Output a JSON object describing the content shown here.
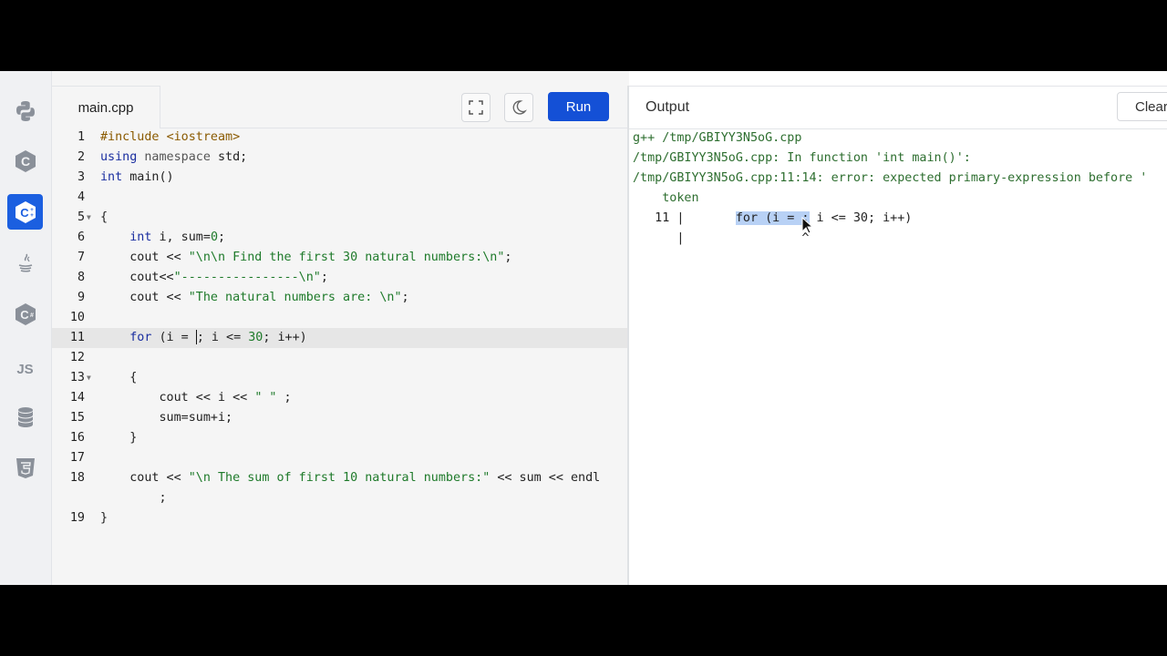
{
  "sidebar": {
    "languages": [
      {
        "name": "Python",
        "icon": "python-icon"
      },
      {
        "name": "C",
        "icon": "c-icon"
      },
      {
        "name": "C++",
        "icon": "cpp-icon",
        "active": true
      },
      {
        "name": "Java",
        "icon": "java-icon"
      },
      {
        "name": "C#",
        "icon": "csharp-icon"
      },
      {
        "name": "JavaScript",
        "icon": "js-icon",
        "label": "JS"
      },
      {
        "name": "SQL",
        "icon": "database-icon"
      },
      {
        "name": "HTML",
        "icon": "html5-icon"
      }
    ]
  },
  "editor": {
    "file_name": "main.cpp",
    "run_label": "Run",
    "active_line": 11,
    "lines": [
      {
        "n": "1",
        "text": "#include <iostream>"
      },
      {
        "n": "2",
        "text": "using namespace std;"
      },
      {
        "n": "3",
        "text": "int main()"
      },
      {
        "n": "4",
        "text": ""
      },
      {
        "n": "5",
        "text": "{"
      },
      {
        "n": "6",
        "text": "    int i, sum=0;"
      },
      {
        "n": "7",
        "text": "    cout << \"\\n\\n Find the first 30 natural numbers:\\n\";"
      },
      {
        "n": "8",
        "text": "    cout<<\"----------------\\n\";"
      },
      {
        "n": "9",
        "text": "    cout << \"The natural numbers are: \\n\";"
      },
      {
        "n": "10",
        "text": ""
      },
      {
        "n": "11",
        "text": "    for (i = ; i <= 30; i++)"
      },
      {
        "n": "12",
        "text": ""
      },
      {
        "n": "13",
        "text": "    {"
      },
      {
        "n": "14",
        "text": "        cout << i << \" \" ;"
      },
      {
        "n": "15",
        "text": "        sum=sum+i;"
      },
      {
        "n": "16",
        "text": "    }"
      },
      {
        "n": "17",
        "text": ""
      },
      {
        "n": "18",
        "text": "    cout << \"\\n The sum of first 10 natural numbers:\" << sum << endl"
      },
      {
        "n": "",
        "text": "        ;"
      },
      {
        "n": "19",
        "text": "}"
      }
    ]
  },
  "output": {
    "title": "Output",
    "clear_label": "Clear",
    "lines": [
      "g++ /tmp/GBIYY3N5oG.cpp",
      "/tmp/GBIYY3N5oG.cpp: In function 'int main()':",
      "/tmp/GBIYY3N5oG.cpp:11:14: error: expected primary-expression before '",
      "    token",
      "   11 |       for (i = ; i <= 30; i++)",
      "      |                ^"
    ],
    "selected_text": "for (i = ;"
  },
  "colors": {
    "accent": "#1450d6",
    "string": "#1e7a2a",
    "keyword": "#1b2fa0"
  }
}
